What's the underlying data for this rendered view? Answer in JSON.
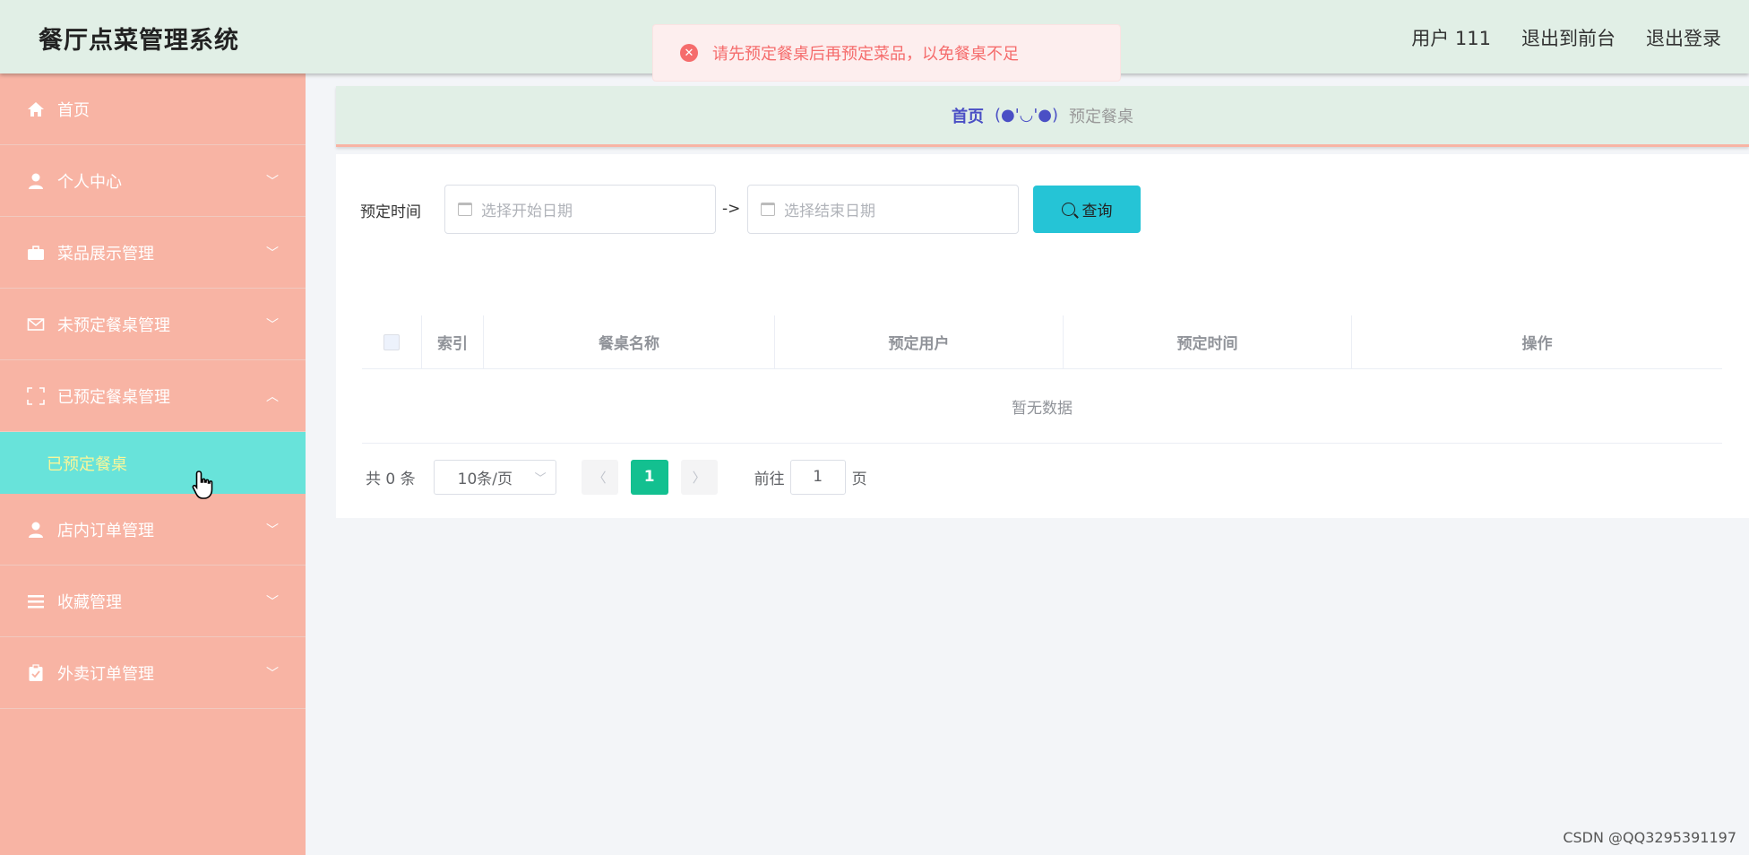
{
  "header": {
    "title": "餐厅点菜管理系统",
    "links": [
      "用户 111",
      "退出到前台",
      "退出登录"
    ]
  },
  "toast": {
    "icon": "error-circle-icon",
    "message": "请先预定餐桌后再预定菜品，以免餐桌不足",
    "color": "#f56c6c"
  },
  "sidebar": {
    "items": [
      {
        "label": "首页",
        "icon": "home-icon"
      },
      {
        "label": "个人中心",
        "icon": "user-icon"
      },
      {
        "label": "菜品展示管理",
        "icon": "briefcase-icon"
      },
      {
        "label": "未预定餐桌管理",
        "icon": "mail-icon"
      },
      {
        "label": "已预定餐桌管理",
        "icon": "frame-icon"
      },
      {
        "label": "店内订单管理",
        "icon": "user-icon"
      },
      {
        "label": "收藏管理",
        "icon": "list-icon"
      },
      {
        "label": "外卖订单管理",
        "icon": "clipboard-icon"
      }
    ],
    "active_sub": "已预定餐桌"
  },
  "breadcrumb": {
    "home": "首页",
    "separator": "(●'◡'●)",
    "current": "预定餐桌"
  },
  "filter": {
    "label": "预定时间",
    "start_placeholder": "选择开始日期",
    "arrow": "->",
    "end_placeholder": "选择结束日期",
    "search_label": "查询"
  },
  "table": {
    "columns": [
      "索引",
      "餐桌名称",
      "预定用户",
      "预定时间",
      "操作"
    ],
    "empty_text": "暂无数据"
  },
  "pagination": {
    "total": "共 0 条",
    "page_size": "10条/页",
    "current_page": "1",
    "goto_label": "前往",
    "goto_value": "1",
    "page_suffix": "页"
  },
  "watermark": "CSDN @QQ3295391197",
  "colors": {
    "header_bg": "#e1efe6",
    "sidebar_bg": "#f8b4a4",
    "active_sub_bg": "#68e3da",
    "search_btn": "#25c4d6",
    "page_active": "#13c090"
  }
}
